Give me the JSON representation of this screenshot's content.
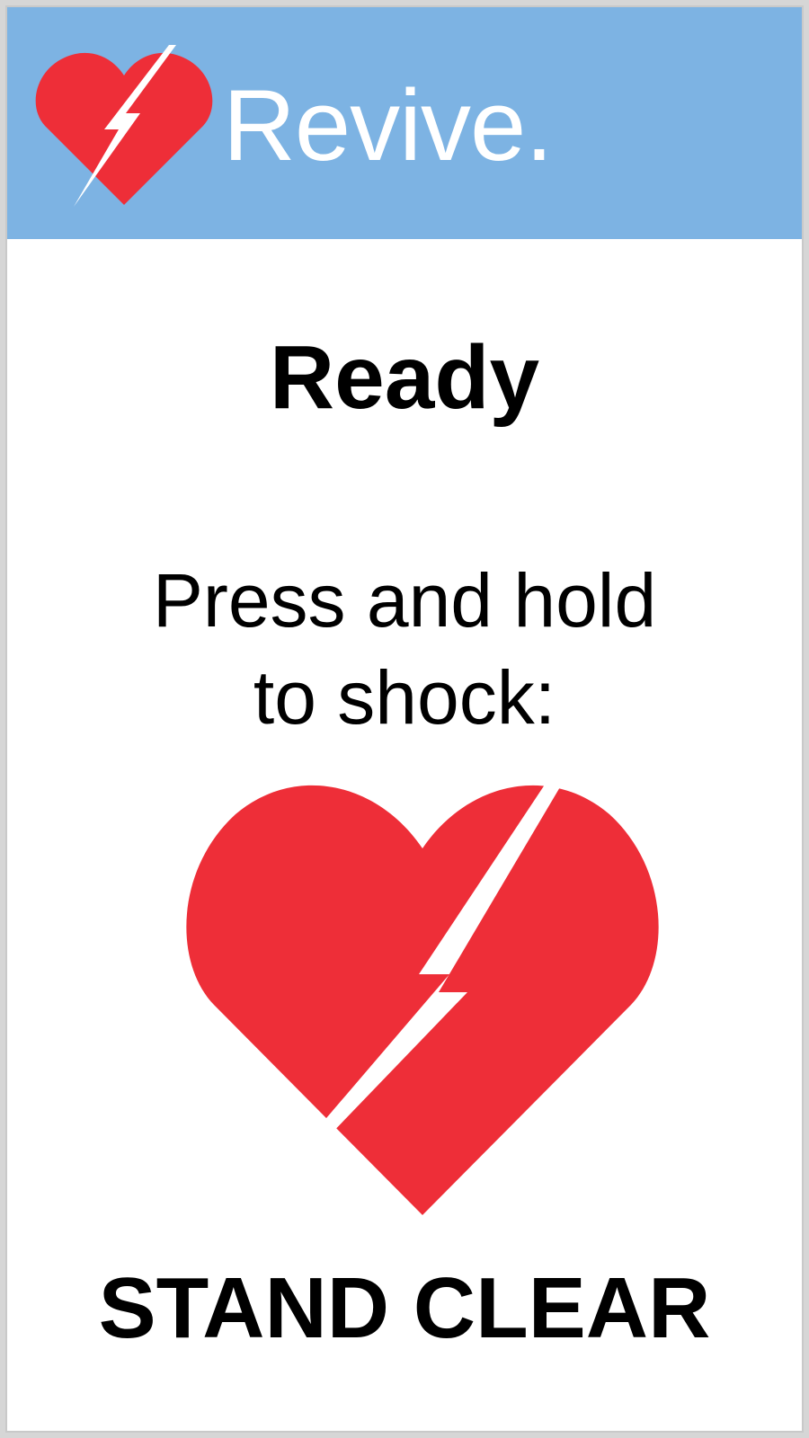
{
  "header": {
    "brand_name": "Revive.",
    "logo_icon": "heart-lightning-icon",
    "background_color": "#7db3e3"
  },
  "status": {
    "title": "Ready"
  },
  "instruction": {
    "line1": "Press and hold",
    "line2": "to shock:"
  },
  "shock_button": {
    "icon": "heart-lightning-icon",
    "color": "#ee2e38"
  },
  "warning": {
    "text": "STAND CLEAR"
  }
}
